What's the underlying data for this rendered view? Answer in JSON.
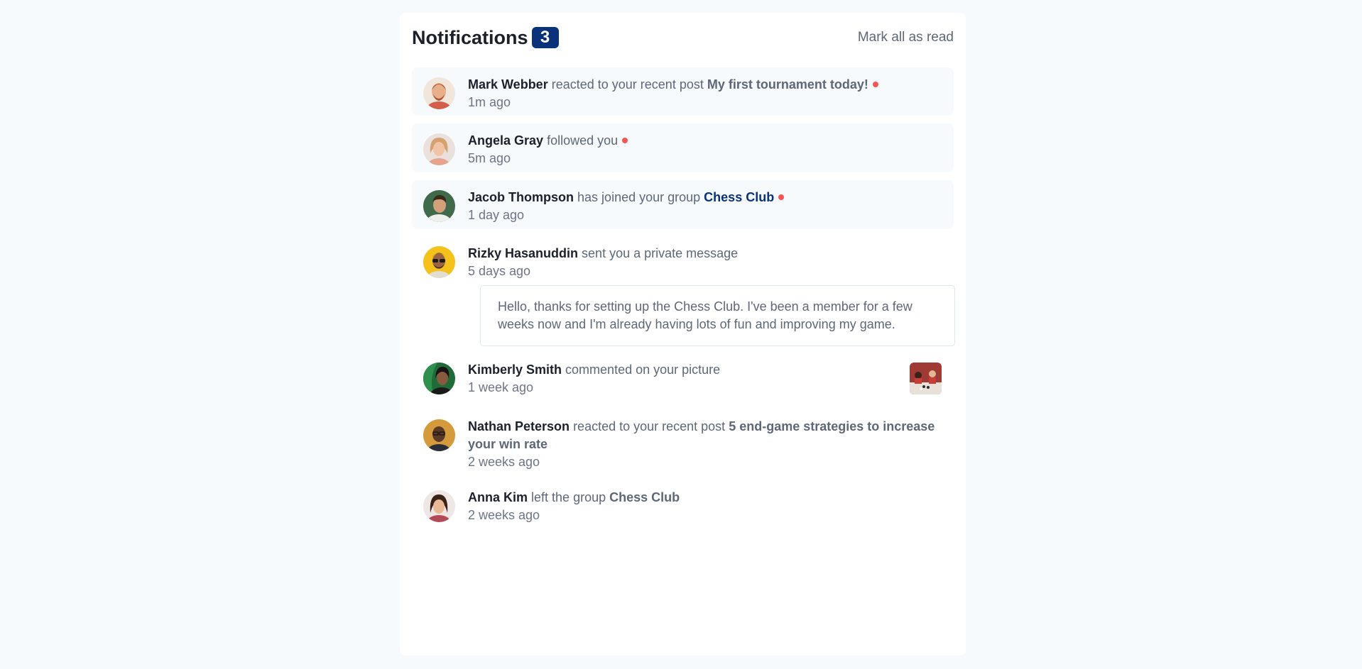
{
  "header": {
    "title": "Notifications",
    "count": "3",
    "mark_all": "Mark all as read"
  },
  "colors": {
    "accent": "#0a327b",
    "unread_dot": "#f65552",
    "unread_bg": "#f7fafd"
  },
  "notifications": [
    {
      "name": "Mark Webber",
      "action": "reacted to your recent post",
      "target": "My first tournament today!",
      "time": "1m ago",
      "unread": true
    },
    {
      "name": "Angela Gray",
      "action": "followed you",
      "time": "5m ago",
      "unread": true
    },
    {
      "name": "Jacob Thompson",
      "action": "has joined your group",
      "target": "Chess Club",
      "time": "1 day ago",
      "unread": true
    },
    {
      "name": "Rizky Hasanuddin",
      "action": "sent you a private message",
      "time": "5 days ago",
      "message": "Hello, thanks for setting up the Chess Club. I've been a member for a few weeks now and I'm already having lots of fun and improving my game."
    },
    {
      "name": "Kimberly Smith",
      "action": "commented on your picture",
      "time": "1 week ago"
    },
    {
      "name": "Nathan Peterson",
      "action": "reacted to your recent post",
      "target": "5 end-game strategies to increase your win rate",
      "time": "2 weeks ago"
    },
    {
      "name": "Anna Kim",
      "action": "left the group",
      "target": "Chess Club",
      "time": "2 weeks ago"
    }
  ]
}
